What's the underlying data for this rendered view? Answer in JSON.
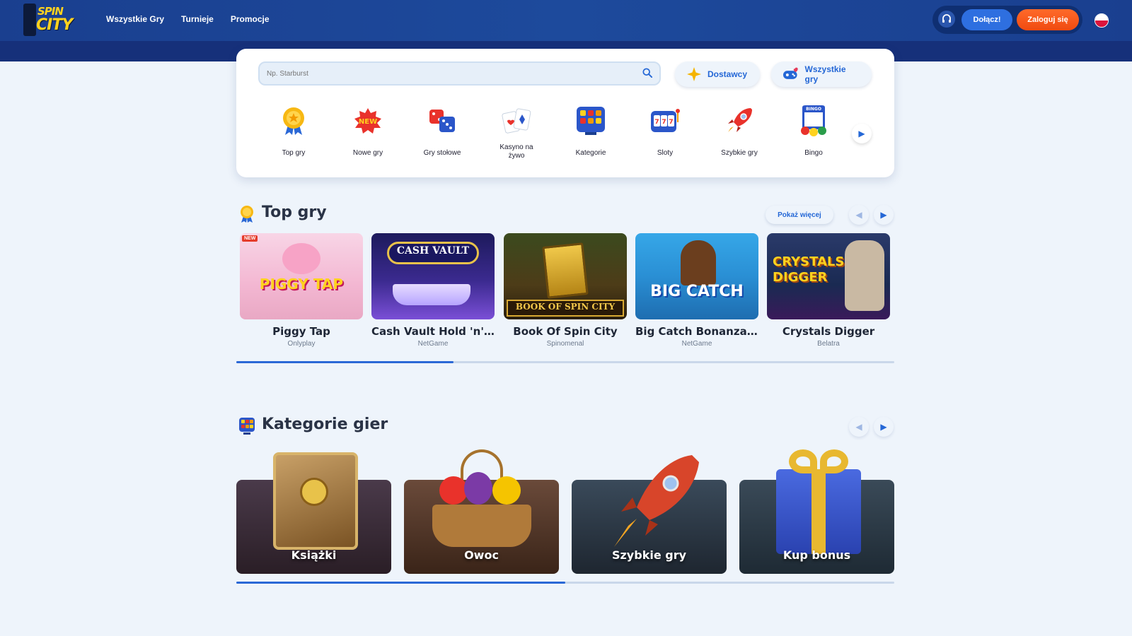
{
  "header": {
    "logo_top": "SPIN",
    "logo_bottom": "CITY",
    "nav": [
      "Wszystkie Gry",
      "Turnieje",
      "Promocje"
    ],
    "join_label": "Dołącz!",
    "login_label": "Zaloguj się"
  },
  "search": {
    "placeholder": "Np. Starburst",
    "providers_label": "Dostawcy",
    "all_games_label": "Wszystkie gry"
  },
  "categories": [
    {
      "label": "Top gry",
      "icon": "medal-icon"
    },
    {
      "label": "Nowe gry",
      "icon": "new-burst-icon"
    },
    {
      "label": "Gry stołowe",
      "icon": "dice-icon"
    },
    {
      "label": "Kasyno na żywo",
      "icon": "cards-icon"
    },
    {
      "label": "Kategorie",
      "icon": "grid-icon"
    },
    {
      "label": "Sloty",
      "icon": "slot-machine-icon"
    },
    {
      "label": "Szybkie gry",
      "icon": "rocket-icon"
    },
    {
      "label": "Bingo",
      "icon": "bingo-icon"
    }
  ],
  "top_games": {
    "title": "Top gry",
    "show_more": "Pokaż więcej",
    "games": [
      {
        "name": "Piggy Tap",
        "provider": "Onlyplay",
        "art": "PIGGY TAP",
        "badge": "NEW"
      },
      {
        "name": "Cash Vault Hold 'n' Li...",
        "provider": "NetGame",
        "art": "CASH VAULT"
      },
      {
        "name": "Book Of Spin City",
        "provider": "Spinomenal",
        "art": "BOOK OF SPIN CITY"
      },
      {
        "name": "Big Catch Bonanza: B...",
        "provider": "NetGame",
        "art": "BIG CATCH"
      },
      {
        "name": "Crystals Digger",
        "provider": "Belatra",
        "art": "CRYSTALS DIGGER"
      }
    ],
    "scroll_fraction": 0.33
  },
  "game_categories": {
    "title": "Kategorie gier",
    "items": [
      {
        "label": "Książki"
      },
      {
        "label": "Owoc"
      },
      {
        "label": "Szybkie gry"
      },
      {
        "label": "Kup bonus"
      }
    ],
    "scroll_fraction": 0.5
  },
  "colors": {
    "header": "#1a3f8f",
    "accent": "#2467d6",
    "login": "#f04a10",
    "logo": "#ffd21e"
  }
}
